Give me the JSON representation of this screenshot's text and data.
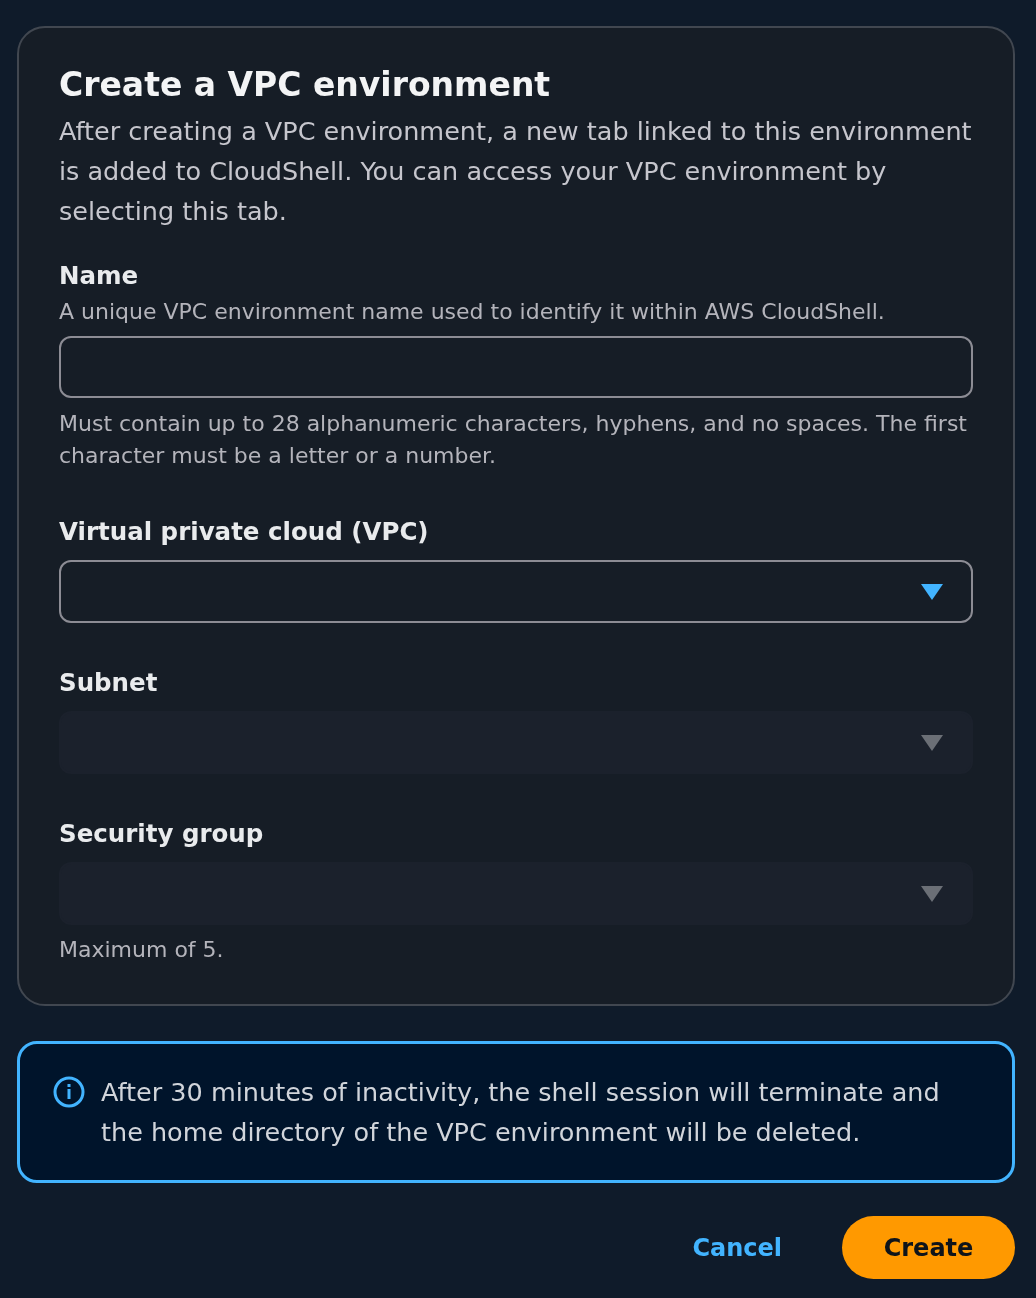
{
  "dialog": {
    "title": "Create a VPC environment",
    "description": "After creating a VPC environment, a new tab linked to this environment is added to CloudShell. You can access your VPC environment by selecting this tab."
  },
  "fields": [
    {
      "kind": "text",
      "label": "Name",
      "description": "A unique VPC environment name used to identify it within AWS CloudShell.",
      "constraint": "Must contain up to 28 alphanumeric characters, hyphens, and no spaces. The first character must be a letter or a number.",
      "disabled": false
    },
    {
      "kind": "select",
      "label": "Virtual private cloud (VPC)",
      "disabled": false
    },
    {
      "kind": "select",
      "label": "Subnet",
      "disabled": true
    },
    {
      "kind": "select",
      "label": "Security group",
      "disabled": true,
      "constraint": "Maximum of 5."
    }
  ],
  "alert": {
    "text": "After 30 minutes of inactivity, the shell session will terminate and the home directory of the VPC environment will be deleted."
  },
  "buttons": [
    {
      "kind": "link",
      "label": "Cancel"
    },
    {
      "kind": "primary",
      "label": "Create"
    }
  ]
}
